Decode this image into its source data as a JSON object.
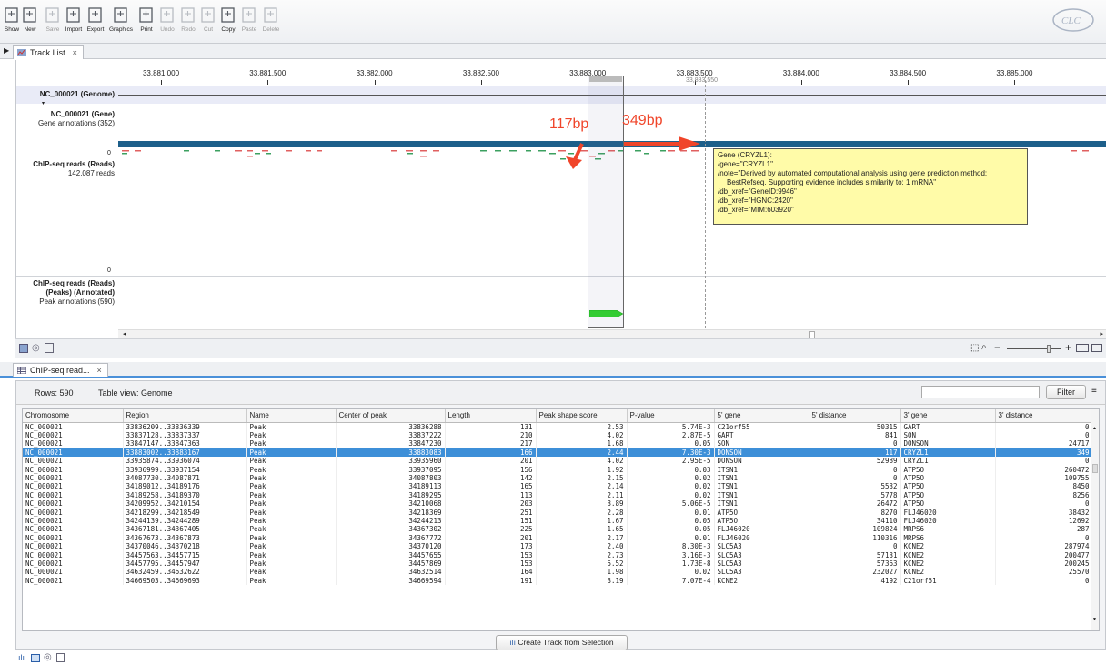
{
  "toolbar": {
    "buttons": [
      {
        "label": "Show",
        "icon": "show-icon",
        "enabled": true
      },
      {
        "label": "New",
        "icon": "new-icon",
        "enabled": true
      },
      {
        "label": "Save",
        "icon": "save-icon",
        "enabled": false
      },
      {
        "label": "Import",
        "icon": "import-icon",
        "enabled": true
      },
      {
        "label": "Export",
        "icon": "export-icon",
        "enabled": true
      },
      {
        "label": "Graphics",
        "icon": "graphics-icon",
        "enabled": true
      },
      {
        "label": "Print",
        "icon": "print-icon",
        "enabled": true
      },
      {
        "label": "Undo",
        "icon": "undo-icon",
        "enabled": false
      },
      {
        "label": "Redo",
        "icon": "redo-icon",
        "enabled": false
      },
      {
        "label": "Cut",
        "icon": "cut-icon",
        "enabled": false
      },
      {
        "label": "Copy",
        "icon": "copy-icon",
        "enabled": true
      },
      {
        "label": "Paste",
        "icon": "paste-icon",
        "enabled": false
      },
      {
        "label": "Delete",
        "icon": "delete-icon",
        "enabled": false
      }
    ]
  },
  "track_tab": {
    "label": "Track List",
    "close": "×"
  },
  "ruler": {
    "ticks": [
      "33,881,000",
      "33,881,500",
      "33,882,000",
      "33,882,500",
      "33,883,000",
      "33,883,500",
      "33,884,000",
      "33,884,500",
      "33,885,000"
    ],
    "cursor_position": "33,883,550"
  },
  "tracks": {
    "genome_label": "NC_000021 (Genome)",
    "gene_label": "NC_000021 (Gene)",
    "gene_sub": "Gene annotations (352)",
    "reads_label": "ChIP-seq reads (Reads)",
    "reads_sub": "142,087 reads",
    "reads_scale_top": "0",
    "reads_scale_bottom": "0",
    "peaks_label_1": "ChIP-seq reads (Reads)",
    "peaks_label_2": "(Peaks) (Annotated)",
    "peaks_sub": "Peak annotations (590)"
  },
  "annotations": {
    "left_distance": "117bp",
    "right_distance": "349bp"
  },
  "tooltip": {
    "lines": [
      "Gene (CRYZL1):",
      "/gene=\"CRYZL1\"",
      "/note=\"Derived by automated computational analysis using gene prediction method:",
      "    BestRefseq. Supporting evidence includes similarity to: 1 mRNA\"",
      "/db_xref=\"GeneID:9946\"",
      "/db_xref=\"HGNC:2420\"",
      "/db_xref=\"MIM:603920\""
    ]
  },
  "table_tab": {
    "label": "ChIP-seq read...",
    "close": "×"
  },
  "table_info": {
    "rows_label": "Rows: 590",
    "view_label": "Table view: Genome",
    "filter_label": "Filter",
    "filter_value": ""
  },
  "table": {
    "columns": [
      "Chromosome",
      "Region",
      "Name",
      "Center of peak",
      "Length",
      "Peak shape score",
      "P-value",
      "5' gene",
      "5' distance",
      "3' gene",
      "3' distance"
    ],
    "selected_row": 3,
    "rows": [
      [
        "NC_000021",
        "33836209..33836339",
        "Peak",
        "33836288",
        "131",
        "2.53",
        "5.74E-3",
        "C21orf55",
        "",
        "50315",
        "GART",
        "0"
      ],
      [
        "NC_000021",
        "33837128..33837337",
        "Peak",
        "33837222",
        "210",
        "4.02",
        "2.87E-5",
        "GART",
        "",
        "841",
        "SON",
        "0"
      ],
      [
        "NC_000021",
        "33847147..33847363",
        "Peak",
        "33847230",
        "217",
        "1.68",
        "0.05",
        "SON",
        "",
        "0",
        "DONSON",
        "24717"
      ],
      [
        "NC_000021",
        "33883002..33883167",
        "Peak",
        "33883083",
        "166",
        "2.44",
        "7.30E-3",
        "DONSON",
        "",
        "117",
        "CRYZL1",
        "349"
      ],
      [
        "NC_000021",
        "33935874..33936074",
        "Peak",
        "33935960",
        "201",
        "4.02",
        "2.95E-5",
        "DONSON",
        "",
        "52989",
        "CRYZL1",
        "0"
      ],
      [
        "NC_000021",
        "33936999..33937154",
        "Peak",
        "33937095",
        "156",
        "1.92",
        "0.03",
        "ITSN1",
        "",
        "0",
        "ATP5O",
        "260472"
      ],
      [
        "NC_000021",
        "34087730..34087871",
        "Peak",
        "34087803",
        "142",
        "2.15",
        "0.02",
        "ITSN1",
        "",
        "0",
        "ATP5O",
        "109755"
      ],
      [
        "NC_000021",
        "34189012..34189176",
        "Peak",
        "34189113",
        "165",
        "2.14",
        "0.02",
        "ITSN1",
        "",
        "5532",
        "ATP5O",
        "8450"
      ],
      [
        "NC_000021",
        "34189258..34189370",
        "Peak",
        "34189295",
        "113",
        "2.11",
        "0.02",
        "ITSN1",
        "",
        "5778",
        "ATP5O",
        "8256"
      ],
      [
        "NC_000021",
        "34209952..34210154",
        "Peak",
        "34210068",
        "203",
        "3.89",
        "5.06E-5",
        "ITSN1",
        "",
        "26472",
        "ATP5O",
        "0"
      ],
      [
        "NC_000021",
        "34218299..34218549",
        "Peak",
        "34218369",
        "251",
        "2.28",
        "0.01",
        "ATP5O",
        "",
        "8270",
        "FLJ46020",
        "38432"
      ],
      [
        "NC_000021",
        "34244139..34244289",
        "Peak",
        "34244213",
        "151",
        "1.67",
        "0.05",
        "ATP5O",
        "",
        "34110",
        "FLJ46020",
        "12692"
      ],
      [
        "NC_000021",
        "34367181..34367405",
        "Peak",
        "34367302",
        "225",
        "1.65",
        "0.05",
        "FLJ46020",
        "",
        "109824",
        "MRPS6",
        "287"
      ],
      [
        "NC_000021",
        "34367673..34367873",
        "Peak",
        "34367772",
        "201",
        "2.17",
        "0.01",
        "FLJ46020",
        "",
        "110316",
        "MRPS6",
        "0"
      ],
      [
        "NC_000021",
        "34370046..34370218",
        "Peak",
        "34370120",
        "173",
        "2.40",
        "8.30E-3",
        "SLC5A3",
        "",
        "0",
        "KCNE2",
        "287974"
      ],
      [
        "NC_000021",
        "34457563..34457715",
        "Peak",
        "34457655",
        "153",
        "2.73",
        "3.16E-3",
        "SLC5A3",
        "",
        "57131",
        "KCNE2",
        "200477"
      ],
      [
        "NC_000021",
        "34457795..34457947",
        "Peak",
        "34457869",
        "153",
        "5.52",
        "1.73E-8",
        "SLC5A3",
        "",
        "57363",
        "KCNE2",
        "200245"
      ],
      [
        "NC_000021",
        "34632459..34632622",
        "Peak",
        "34632514",
        "164",
        "1.98",
        "0.02",
        "SLC5A3",
        "",
        "232027",
        "KCNE2",
        "25570"
      ],
      [
        "NC_000021",
        "34669503..34669693",
        "Peak",
        "34669594",
        "191",
        "3.19",
        "7.07E-4",
        "KCNE2",
        "",
        "4192",
        "C21orf51",
        "0"
      ]
    ]
  },
  "create_track_button": "Create Track from Selection",
  "colors": {
    "gene_bar": "#1d5f8a",
    "annotation_red": "#f0452a",
    "selection_blue": "#3d8fd8",
    "peak_green": "#33cc33",
    "tooltip_bg": "#fffba8"
  }
}
